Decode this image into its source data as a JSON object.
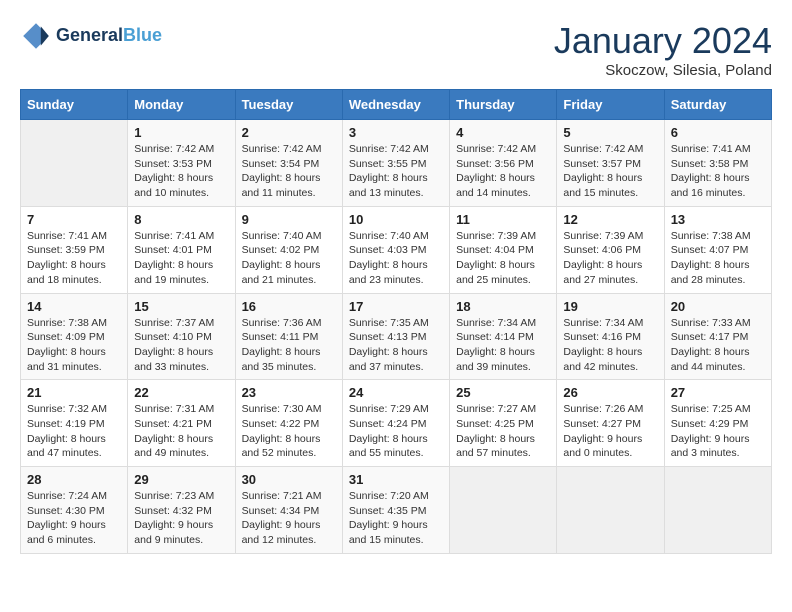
{
  "header": {
    "logo_line1": "General",
    "logo_line2": "Blue",
    "month": "January 2024",
    "location": "Skoczow, Silesia, Poland"
  },
  "days_of_week": [
    "Sunday",
    "Monday",
    "Tuesday",
    "Wednesday",
    "Thursday",
    "Friday",
    "Saturday"
  ],
  "weeks": [
    [
      {
        "num": "",
        "info": ""
      },
      {
        "num": "1",
        "info": "Sunrise: 7:42 AM\nSunset: 3:53 PM\nDaylight: 8 hours\nand 10 minutes."
      },
      {
        "num": "2",
        "info": "Sunrise: 7:42 AM\nSunset: 3:54 PM\nDaylight: 8 hours\nand 11 minutes."
      },
      {
        "num": "3",
        "info": "Sunrise: 7:42 AM\nSunset: 3:55 PM\nDaylight: 8 hours\nand 13 minutes."
      },
      {
        "num": "4",
        "info": "Sunrise: 7:42 AM\nSunset: 3:56 PM\nDaylight: 8 hours\nand 14 minutes."
      },
      {
        "num": "5",
        "info": "Sunrise: 7:42 AM\nSunset: 3:57 PM\nDaylight: 8 hours\nand 15 minutes."
      },
      {
        "num": "6",
        "info": "Sunrise: 7:41 AM\nSunset: 3:58 PM\nDaylight: 8 hours\nand 16 minutes."
      }
    ],
    [
      {
        "num": "7",
        "info": "Sunrise: 7:41 AM\nSunset: 3:59 PM\nDaylight: 8 hours\nand 18 minutes."
      },
      {
        "num": "8",
        "info": "Sunrise: 7:41 AM\nSunset: 4:01 PM\nDaylight: 8 hours\nand 19 minutes."
      },
      {
        "num": "9",
        "info": "Sunrise: 7:40 AM\nSunset: 4:02 PM\nDaylight: 8 hours\nand 21 minutes."
      },
      {
        "num": "10",
        "info": "Sunrise: 7:40 AM\nSunset: 4:03 PM\nDaylight: 8 hours\nand 23 minutes."
      },
      {
        "num": "11",
        "info": "Sunrise: 7:39 AM\nSunset: 4:04 PM\nDaylight: 8 hours\nand 25 minutes."
      },
      {
        "num": "12",
        "info": "Sunrise: 7:39 AM\nSunset: 4:06 PM\nDaylight: 8 hours\nand 27 minutes."
      },
      {
        "num": "13",
        "info": "Sunrise: 7:38 AM\nSunset: 4:07 PM\nDaylight: 8 hours\nand 28 minutes."
      }
    ],
    [
      {
        "num": "14",
        "info": "Sunrise: 7:38 AM\nSunset: 4:09 PM\nDaylight: 8 hours\nand 31 minutes."
      },
      {
        "num": "15",
        "info": "Sunrise: 7:37 AM\nSunset: 4:10 PM\nDaylight: 8 hours\nand 33 minutes."
      },
      {
        "num": "16",
        "info": "Sunrise: 7:36 AM\nSunset: 4:11 PM\nDaylight: 8 hours\nand 35 minutes."
      },
      {
        "num": "17",
        "info": "Sunrise: 7:35 AM\nSunset: 4:13 PM\nDaylight: 8 hours\nand 37 minutes."
      },
      {
        "num": "18",
        "info": "Sunrise: 7:34 AM\nSunset: 4:14 PM\nDaylight: 8 hours\nand 39 minutes."
      },
      {
        "num": "19",
        "info": "Sunrise: 7:34 AM\nSunset: 4:16 PM\nDaylight: 8 hours\nand 42 minutes."
      },
      {
        "num": "20",
        "info": "Sunrise: 7:33 AM\nSunset: 4:17 PM\nDaylight: 8 hours\nand 44 minutes."
      }
    ],
    [
      {
        "num": "21",
        "info": "Sunrise: 7:32 AM\nSunset: 4:19 PM\nDaylight: 8 hours\nand 47 minutes."
      },
      {
        "num": "22",
        "info": "Sunrise: 7:31 AM\nSunset: 4:21 PM\nDaylight: 8 hours\nand 49 minutes."
      },
      {
        "num": "23",
        "info": "Sunrise: 7:30 AM\nSunset: 4:22 PM\nDaylight: 8 hours\nand 52 minutes."
      },
      {
        "num": "24",
        "info": "Sunrise: 7:29 AM\nSunset: 4:24 PM\nDaylight: 8 hours\nand 55 minutes."
      },
      {
        "num": "25",
        "info": "Sunrise: 7:27 AM\nSunset: 4:25 PM\nDaylight: 8 hours\nand 57 minutes."
      },
      {
        "num": "26",
        "info": "Sunrise: 7:26 AM\nSunset: 4:27 PM\nDaylight: 9 hours\nand 0 minutes."
      },
      {
        "num": "27",
        "info": "Sunrise: 7:25 AM\nSunset: 4:29 PM\nDaylight: 9 hours\nand 3 minutes."
      }
    ],
    [
      {
        "num": "28",
        "info": "Sunrise: 7:24 AM\nSunset: 4:30 PM\nDaylight: 9 hours\nand 6 minutes."
      },
      {
        "num": "29",
        "info": "Sunrise: 7:23 AM\nSunset: 4:32 PM\nDaylight: 9 hours\nand 9 minutes."
      },
      {
        "num": "30",
        "info": "Sunrise: 7:21 AM\nSunset: 4:34 PM\nDaylight: 9 hours\nand 12 minutes."
      },
      {
        "num": "31",
        "info": "Sunrise: 7:20 AM\nSunset: 4:35 PM\nDaylight: 9 hours\nand 15 minutes."
      },
      {
        "num": "",
        "info": ""
      },
      {
        "num": "",
        "info": ""
      },
      {
        "num": "",
        "info": ""
      }
    ]
  ]
}
